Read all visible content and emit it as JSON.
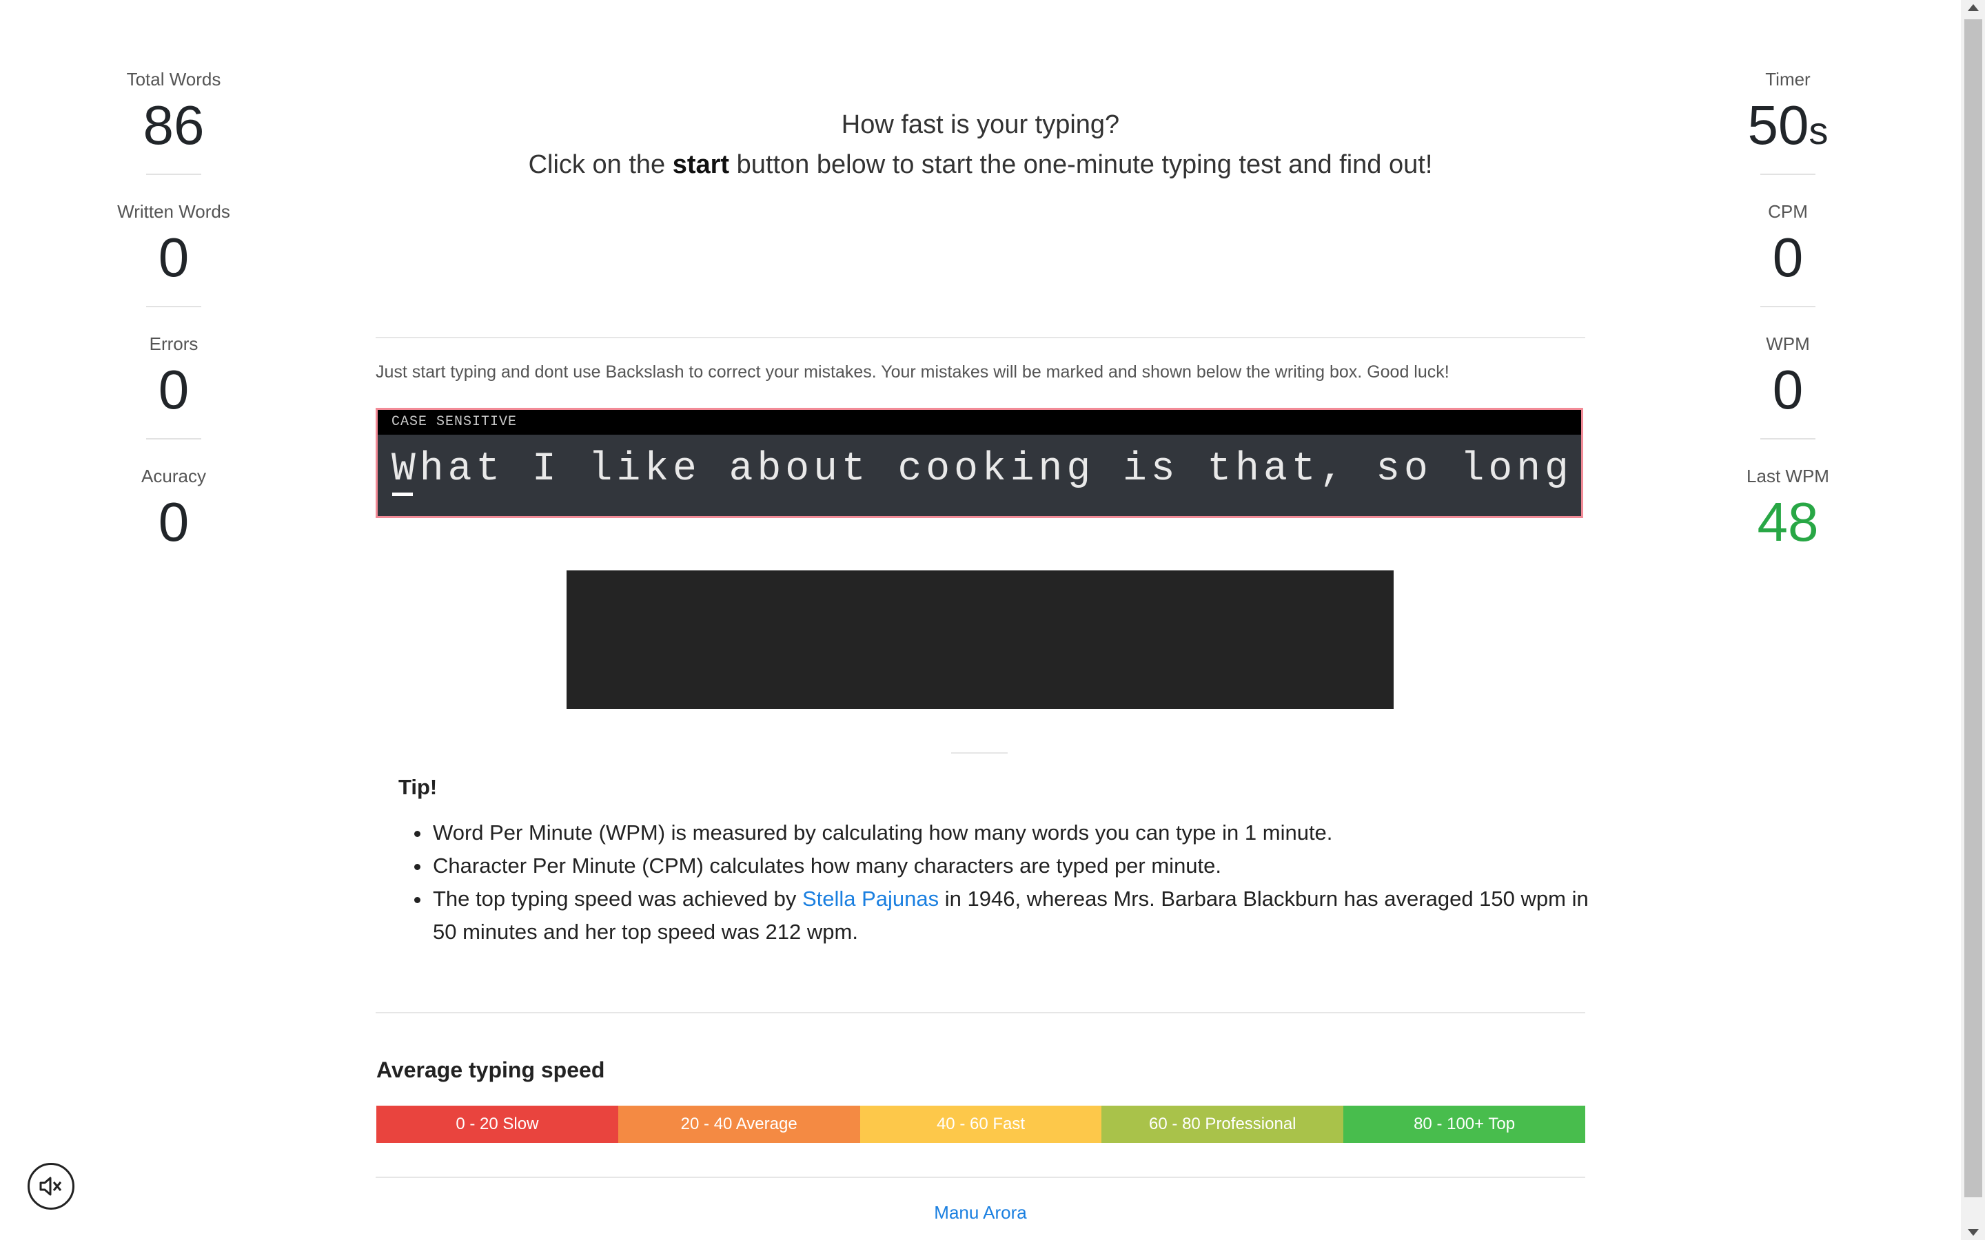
{
  "left_stats": [
    {
      "label": "Total Words",
      "value": "86"
    },
    {
      "label": "Written Words",
      "value": "0"
    },
    {
      "label": "Errors",
      "value": "0"
    },
    {
      "label": "Acuracy",
      "value": "0"
    }
  ],
  "right_stats": [
    {
      "label": "Timer",
      "value": "50",
      "unit": "s"
    },
    {
      "label": "CPM",
      "value": "0"
    },
    {
      "label": "WPM",
      "value": "0"
    },
    {
      "label": "Last WPM",
      "value": "48"
    }
  ],
  "headline": {
    "question": "How fast is your typing?",
    "prefix": "Click on the ",
    "bold": "start",
    "suffix": " button below to start the one-minute typing test and find out!"
  },
  "instructions": "Just start typing and dont use Backslash to correct your mistakes. Your mistakes will be marked and shown below the writing box. Good luck!",
  "typing_box": {
    "header": "CASE SENSITIVE",
    "text": "What I like about cooking is that, so long as"
  },
  "tip": {
    "title": "Tip!",
    "items": [
      "Word Per Minute (WPM) is measured by calculating how many words you can type in 1 minute.",
      "Character Per Minute (CPM) calculates how many characters are typed per minute."
    ],
    "item3_prefix": "The top typing speed was achieved by ",
    "item3_link": "Stella Pajunas",
    "item3_suffix": " in 1946, whereas Mrs. Barbara Blackburn has averaged 150 wpm in 50 minutes and her top speed was 212 wpm."
  },
  "speed": {
    "title": "Average typing speed",
    "segments": [
      {
        "label": "0 - 20 Slow",
        "color": "#e9443e"
      },
      {
        "label": "20 - 40 Average",
        "color": "#f48a43"
      },
      {
        "label": "40 - 60 Fast",
        "color": "#fdc84a"
      },
      {
        "label": "60 - 80 Professional",
        "color": "#a9c24a"
      },
      {
        "label": "80 - 100+ Top",
        "color": "#48bd4d"
      }
    ]
  },
  "footer": {
    "author": "Manu Arora"
  },
  "colors": {
    "accent": "#1a7fe0",
    "last_wpm": "#28a745"
  },
  "icons": {
    "mute": "speaker-mute-icon"
  }
}
